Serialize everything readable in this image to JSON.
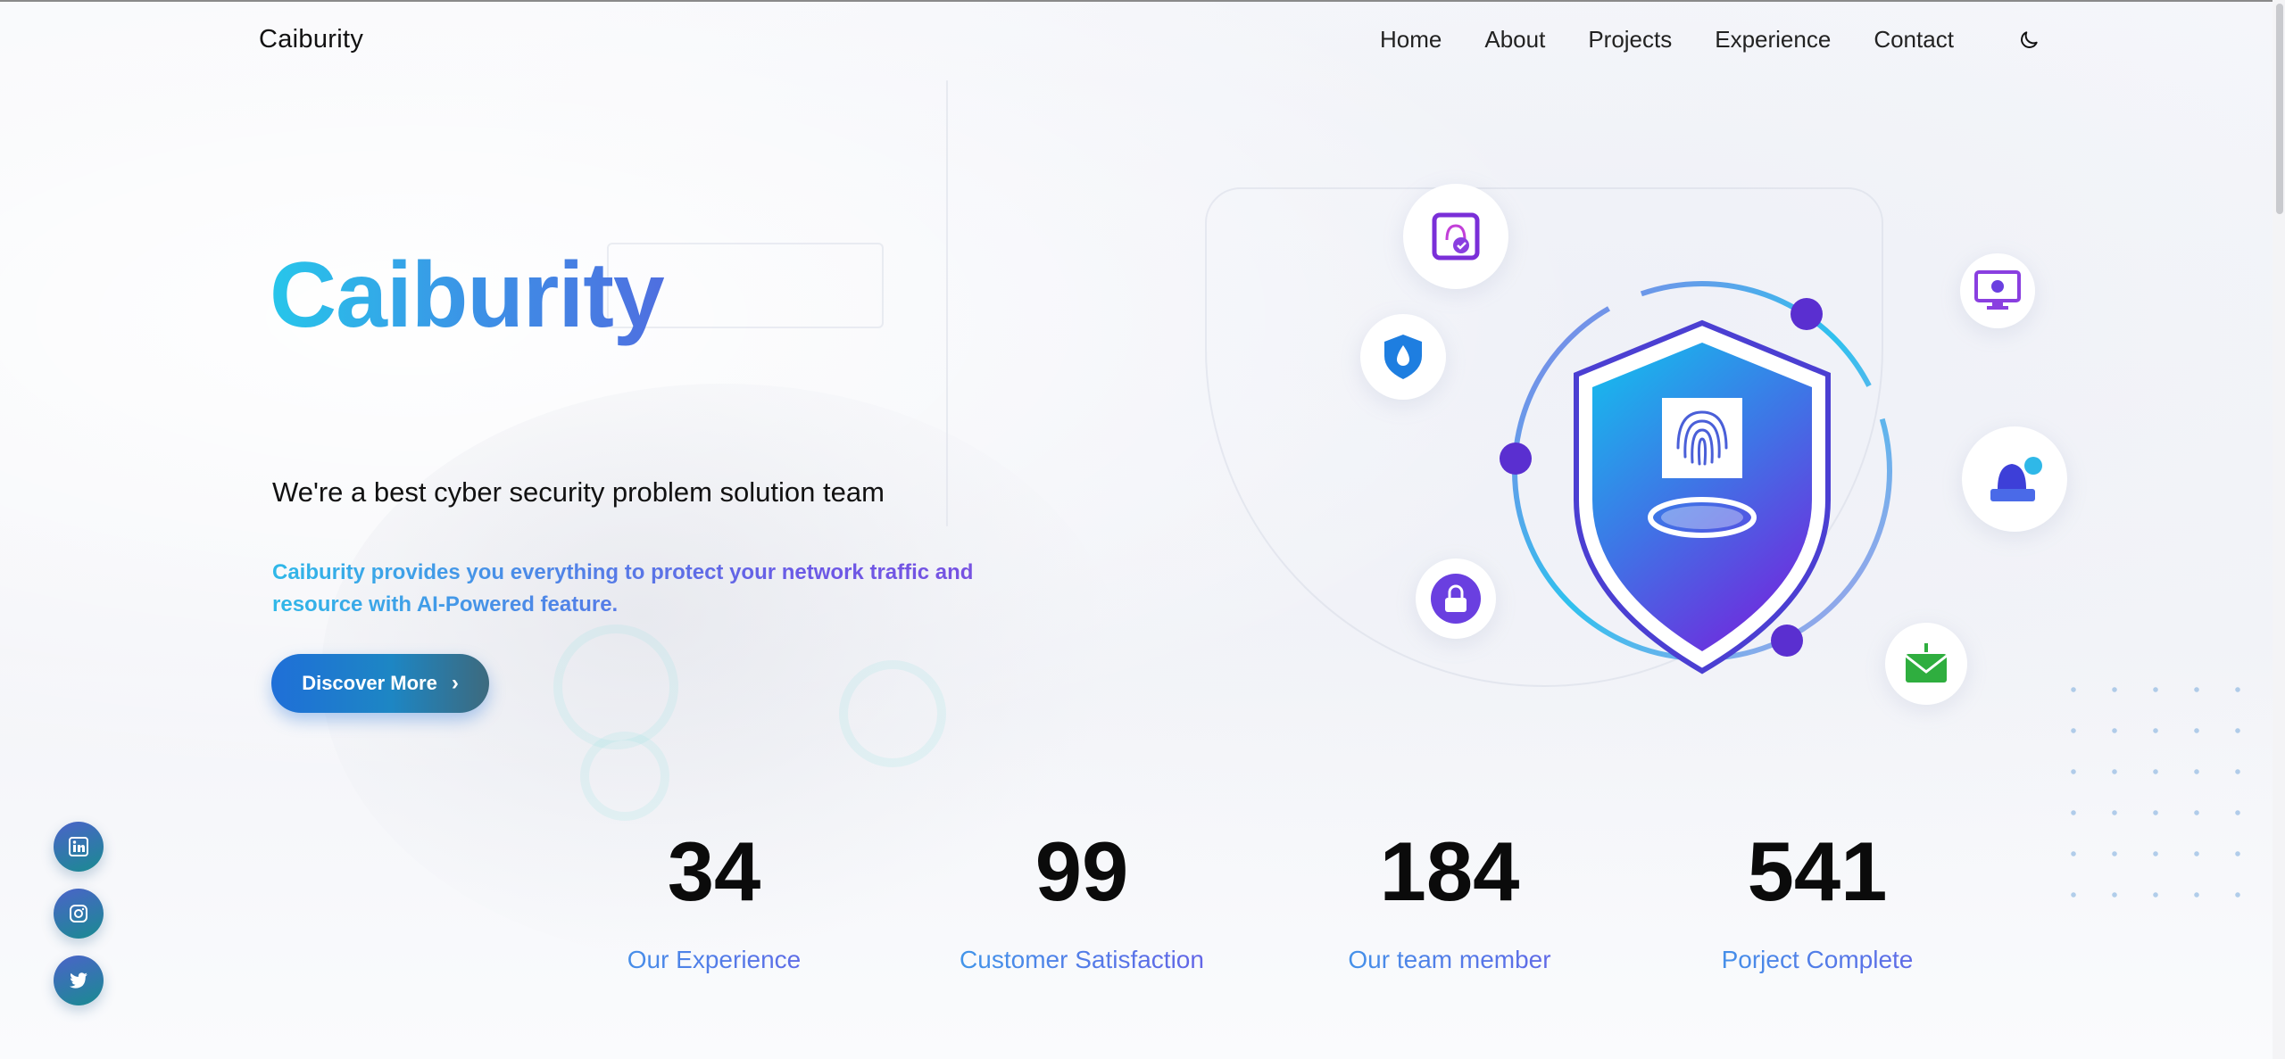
{
  "header": {
    "logo": "Caiburity",
    "nav": [
      "Home",
      "About",
      "Projects",
      "Experience",
      "Contact"
    ],
    "theme_toggle_icon": "moon-icon"
  },
  "hero": {
    "title": "Caiburity",
    "subtitle": "We're a best cyber security problem solution team",
    "description": "Caiburity provides you everything to protect your network traffic and resource with AI-Powered feature.",
    "cta_label": "Discover More",
    "cta_icon": "chevron-right-icon"
  },
  "illustration": {
    "center_icon": "shield-fingerprint-icon",
    "orbit_icons": [
      "fingerprint-lock-icon",
      "water-shield-icon",
      "lock-keypad-icon",
      "virus-monitor-icon",
      "hacker-icon",
      "mail-alert-icon"
    ]
  },
  "stats": [
    {
      "value": "34",
      "label": "Our Experience"
    },
    {
      "value": "99",
      "label": "Customer Satisfaction"
    },
    {
      "value": "184",
      "label": "Our team member"
    },
    {
      "value": "541",
      "label": "Porject Complete"
    }
  ],
  "socials": [
    "linkedin-icon",
    "instagram-icon",
    "twitter-icon"
  ],
  "colors": {
    "accent_cyan": "#27c6ea",
    "accent_blue": "#3d8fe6",
    "accent_purple": "#6a3fe0",
    "button": "#1f6fd8"
  }
}
